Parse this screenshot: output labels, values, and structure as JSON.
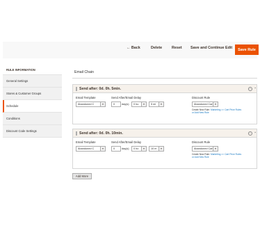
{
  "toolbar": {
    "back_label": "← Back",
    "delete_label": "Delete",
    "reset_label": "Reset",
    "save_continue_label": "Save and Continue Edit",
    "save_label": "Save Rule"
  },
  "sidebar": {
    "title": "RULE INFORMATION",
    "items": [
      {
        "label": "General Settings"
      },
      {
        "label": "Stores & Customer Groups"
      },
      {
        "label": "Schedule"
      },
      {
        "label": "Conditions"
      },
      {
        "label": "Discount Code Settings"
      }
    ],
    "active_index": 2
  },
  "main": {
    "section_title": "Email Chain",
    "chains": [
      {
        "title": "Send after: 0d. 0h. 5min.",
        "email_template_label": "Email Template",
        "email_template_value": "Abandoned C",
        "delay_label": "Send After/Email Delay",
        "days_value": "0",
        "days_label": "day(s)",
        "hours_value": "0 ho",
        "minutes_value": "5 mi",
        "discount_rule_label": "Discount Rule",
        "discount_rule_value": "Abandoned Cart",
        "create_text": "Create New Rule:",
        "create_link": "Marketing >> Cart Price Rules",
        "add_link": "or Add New Rule"
      },
      {
        "title": "Send after: 0d. 0h. 10min.",
        "email_template_label": "Email Template",
        "email_template_value": "Abandoned C",
        "delay_label": "Send After/Email Delay",
        "days_value": "0",
        "days_label": "day(s)",
        "hours_value": "0 ho",
        "minutes_value": "10 m",
        "discount_rule_label": "Discount Rule",
        "discount_rule_value": "Abandoned Cart",
        "create_text": "Create New Rule:",
        "create_link": "Marketing >> Cart Price Rules",
        "add_link": "or Add New Rule"
      }
    ],
    "add_more_label": "Add More"
  },
  "icons": {
    "dropdown": "chevron-down-icon",
    "toggle": "collapse-icon",
    "delete": "trash-icon",
    "drag": "drag-handle-icon"
  },
  "colors": {
    "accent": "#eb5202",
    "link": "#1979c3",
    "chain_header_bg": "#f6f1eb"
  }
}
